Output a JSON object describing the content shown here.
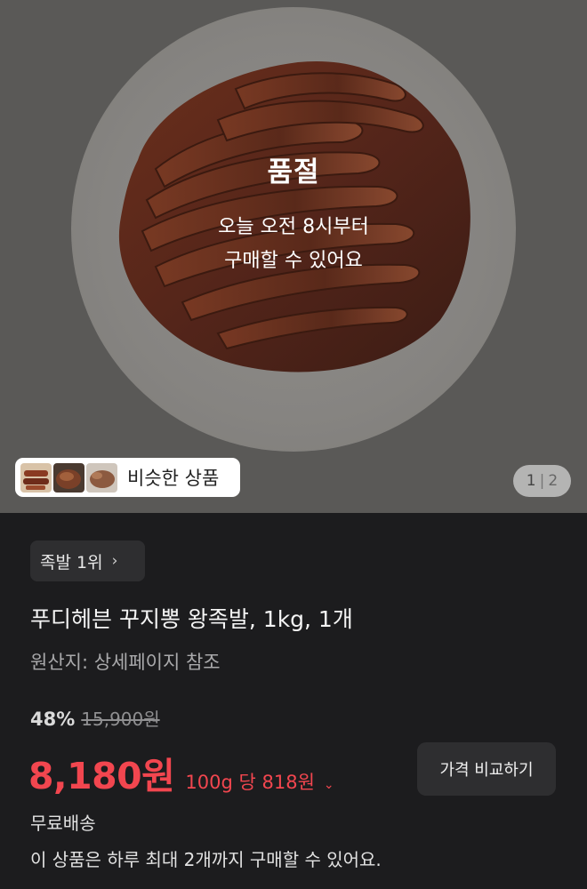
{
  "hero": {
    "soldout_title": "품절",
    "soldout_line1": "오늘 오전 8시부터",
    "soldout_line2": "구매할 수 있어요",
    "similar_label": "비슷한 상품",
    "pager_current": "1",
    "pager_sep": "|",
    "pager_total": "2"
  },
  "product": {
    "rank_label": "족발 1위",
    "rank_chevron": "›",
    "title": "푸디헤븐 꾸지뽕 왕족발, 1kg, 1개",
    "origin": "원산지: 상세페이지 참조",
    "discount_pct": "48%",
    "original_price": "15,900원",
    "price": "8,180원",
    "unit_price": "100g 당 818원",
    "unit_caret": "⌄",
    "compare_button": "가격 비교하기",
    "shipping": "무료배송",
    "limit_notice": "이 상품은 하루 최대 2개까지 구매할 수 있어요."
  },
  "colors": {
    "accent_price": "#f2464f",
    "background": "#1c1c1e",
    "chip_bg": "#2e2e30"
  },
  "icons": [
    "chevron-right-icon",
    "chevron-down-icon"
  ]
}
